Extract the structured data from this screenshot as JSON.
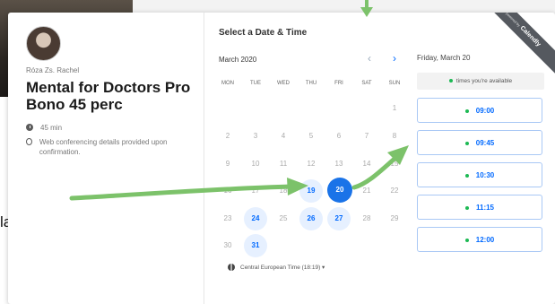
{
  "background": {
    "left_text": "lalj"
  },
  "host": {
    "name": "Róza Zs. Rachel"
  },
  "event": {
    "title": "Mental for Doctors Pro Bono 45 perc",
    "duration": "45 min",
    "conferencing_note": "Web conferencing details provided upon confirmation."
  },
  "calendar": {
    "section_title": "Select a Date & Time",
    "month_label": "March 2020",
    "prev_glyph": "‹",
    "next_glyph": "›",
    "weekdays": [
      "MON",
      "TUE",
      "WED",
      "THU",
      "FRI",
      "SAT",
      "SUN"
    ],
    "days": {
      "d1": "1",
      "d2": "2",
      "d3": "3",
      "d4": "4",
      "d5": "5",
      "d6": "6",
      "d7": "7",
      "d8": "8",
      "d9": "9",
      "d10": "10",
      "d11": "11",
      "d12": "12",
      "d13": "13",
      "d14": "14",
      "d15": "15",
      "d16": "16",
      "d17": "17",
      "d18": "18",
      "d19": "19",
      "d20": "20",
      "d21": "21",
      "d22": "22",
      "d23": "23",
      "d24": "24",
      "d25": "25",
      "d26": "26",
      "d27": "27",
      "d28": "28",
      "d29": "29",
      "d30": "30",
      "d31": "31"
    },
    "selected_day": "20",
    "available_days": [
      "19",
      "20",
      "24",
      "26",
      "27",
      "31"
    ],
    "timezone": "Central European Time (18:19) ▾"
  },
  "times": {
    "selected_date_label": "Friday, March 20",
    "availability_note": "times you're available",
    "slots": [
      "09:00",
      "09:45",
      "10:30",
      "11:15",
      "12:00"
    ]
  },
  "ribbon": {
    "powered_by": "powered by",
    "brand": "Calendly"
  },
  "colors": {
    "accent": "#0069ff",
    "selected": "#1a73e8",
    "available_bg": "#e6f0ff",
    "arrow": "#7cc26a",
    "dot": "#1db954"
  }
}
